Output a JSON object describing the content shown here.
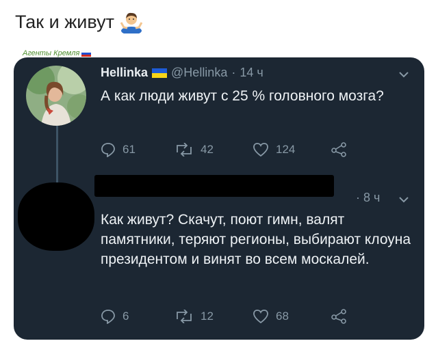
{
  "post": {
    "caption": "Так и живут",
    "caption_emoji": "person-shrugging-emoji",
    "watermark": "Агенты Кремля"
  },
  "tweet1": {
    "name": "Hellinka",
    "flag": "ukraine-flag",
    "handle": "@Hellinka",
    "separator": "·",
    "time": "14 ч",
    "text": "А как люди живут с 25 % головного мозга?",
    "replies": "61",
    "retweets": "42",
    "likes": "124"
  },
  "tweet2": {
    "author_redacted": true,
    "time": "· 8 ч",
    "text": "Как живут? Скачут, поют гимн,  валят памятники, теряют регионы, выбирают клоуна президентом и винят во всем москалей.",
    "replies": "6",
    "retweets": "12",
    "likes": "68"
  },
  "colors": {
    "card_bg": "#1c2733",
    "muted": "#8899a6",
    "text": "#eef2f5"
  }
}
